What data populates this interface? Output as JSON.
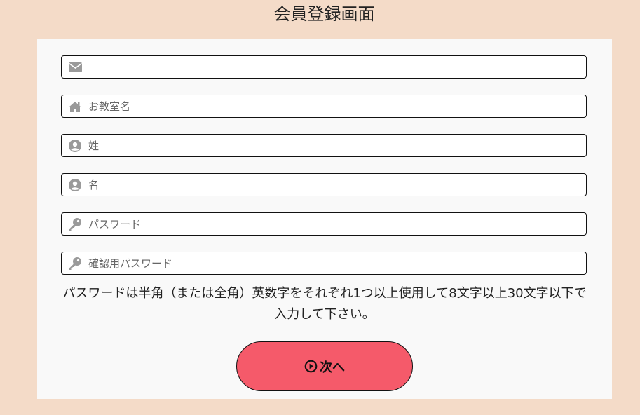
{
  "page": {
    "title": "会員登録画面"
  },
  "form": {
    "fields": [
      {
        "icon": "envelope-icon",
        "placeholder": "",
        "value": ""
      },
      {
        "icon": "home-icon",
        "placeholder": "お教室名",
        "value": ""
      },
      {
        "icon": "user-circle-icon",
        "placeholder": "姓",
        "value": ""
      },
      {
        "icon": "user-circle-icon",
        "placeholder": "名",
        "value": ""
      },
      {
        "icon": "key-icon",
        "placeholder": "パスワード",
        "value": ""
      },
      {
        "icon": "key-icon",
        "placeholder": "確認用パスワード",
        "value": ""
      }
    ],
    "password_note": "パスワードは半角（または全角）英数字をそれぞれ1つ以上使用して8文字以上30文字以下で入力して下さい。",
    "next_label": "次へ",
    "next_icon": "play-circle-icon"
  },
  "colors": {
    "background": "#f4dbc8",
    "card": "#f9f9f9",
    "button": "#f55a6a",
    "icon": "#9a9a9a"
  }
}
